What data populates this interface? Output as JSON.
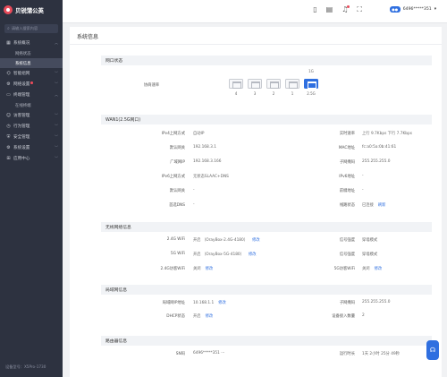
{
  "app": {
    "logo_text": "贝锐蒲公英"
  },
  "sidebar": {
    "search_placeholder": "请输入搜索内容",
    "items": [
      {
        "label": "系统概况",
        "icon": "dashboard-icon",
        "sub": [
          {
            "label": "网络状态"
          },
          {
            "label": "系统信息",
            "active": true
          }
        ]
      },
      {
        "label": "智能组网",
        "icon": "network-icon"
      },
      {
        "label": "网络设置",
        "icon": "settings-icon",
        "dot": true
      },
      {
        "label": "终端管理",
        "icon": "devices-icon",
        "sub": [
          {
            "label": "在线终端"
          }
        ]
      },
      {
        "label": "访客管理",
        "icon": "guest-icon"
      },
      {
        "label": "行为管理",
        "icon": "behavior-icon"
      },
      {
        "label": "安全管理",
        "icon": "shield-icon"
      },
      {
        "label": "系统设置",
        "icon": "gear-icon"
      },
      {
        "label": "应用中心",
        "icon": "apps-icon"
      }
    ],
    "footer": "设备型号：X5Pro-1730"
  },
  "topbar": {
    "user_id": "6496*****351"
  },
  "page_title": "系统信息",
  "ports": {
    "section_title": "网口状态",
    "label": "协商速率",
    "items": [
      {
        "num": "4",
        "speed": "",
        "on": false
      },
      {
        "num": "3",
        "speed": "",
        "on": false
      },
      {
        "num": "2",
        "speed": "",
        "on": false
      },
      {
        "num": "1",
        "speed": "",
        "on": false
      },
      {
        "num": "2.5G",
        "speed": "1G",
        "on": true
      }
    ]
  },
  "wan": {
    "title": "WAN1(2.5G网口)",
    "rows": [
      {
        "l": "IPv4上网方式",
        "lv": "自动IP",
        "r": "实时速率",
        "rv": "上行 9.7Kbps    下行 7.7Kbps"
      },
      {
        "l": "默认网关",
        "lv": "192.168.3.1",
        "r": "MAC地址",
        "rv": "fc:a0:5a:0b:41:61"
      },
      {
        "l": "广域网IP",
        "lv": "192.168.3.166",
        "r": "子网掩码",
        "rv": "255.255.255.0"
      },
      {
        "l": "IPv6上网方式",
        "lv": "无状态SLAAC+DNS",
        "r": "IPv6地址",
        "rv": "-"
      },
      {
        "l": "默认网关",
        "lv": "-",
        "r": "前缀地址",
        "rv": "-"
      },
      {
        "l": "首选DNS",
        "lv": "-",
        "r": "线路状态",
        "rv": "已连接",
        "rlink": "刷新"
      }
    ]
  },
  "wireless": {
    "title": "无线网络信息",
    "rows": [
      {
        "l": "2.4G WiFi",
        "lv": "开启 （OrayBox-2.4G-4180）",
        "llink": "修改",
        "r": "信号强度",
        "rv": "穿墙模式"
      },
      {
        "l": "5G WiFi",
        "lv": "开启 （OrayBox-5G-4180）",
        "llink": "修改",
        "r": "信号强度",
        "rv": "穿墙模式"
      },
      {
        "l": "2.4G访客WiFi",
        "lv": "关闭",
        "llink": "修改",
        "r": "5G访客WiFi",
        "rv": "关闭",
        "rlink": "修改"
      }
    ]
  },
  "lan": {
    "title": "局域网信息",
    "rows": [
      {
        "l": "局域网IP地址",
        "lv": "10.168.1.1",
        "llink": "修改",
        "r": "子网掩码",
        "rv": "255.255.255.0"
      },
      {
        "l": "DHCP状态",
        "lv": "开启",
        "llink": "修改",
        "r": "设备接入数量",
        "rv": "2"
      }
    ]
  },
  "router": {
    "title": "路由器信息",
    "rows": [
      {
        "l": "SN码",
        "lv": "6496*****351  ···",
        "r": "运行时长",
        "rv": "1天 2小时 25分 49秒"
      }
    ]
  },
  "colors": {
    "accent": "#2f6fe0",
    "sidebar_bg": "#2d3240",
    "brand_red": "#e94b5a"
  }
}
